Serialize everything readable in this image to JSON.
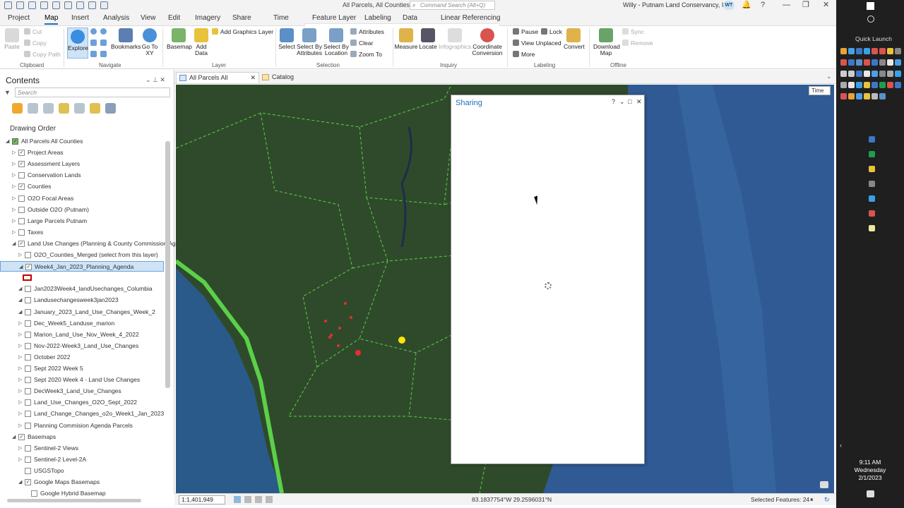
{
  "titlebar": {
    "doc_title": "All Parcels, All Counties",
    "search_placeholder": "Command Search (Alt+Q)",
    "user_name": "Willy - Putnam Land Conservancy, Inc.",
    "user_initials": "WT",
    "minimize": "—",
    "restore": "❐",
    "close": "✕"
  },
  "menu": {
    "tabs": [
      "Project",
      "Map",
      "Insert",
      "Analysis",
      "View",
      "Edit",
      "Imagery",
      "Share",
      "Time",
      "Feature Layer",
      "Labeling",
      "Data",
      "Linear Referencing"
    ],
    "active": "Map"
  },
  "ribbon": {
    "clipboard": {
      "paste": "Paste",
      "cut": "Cut",
      "copy": "Copy",
      "copy_path": "Copy Path",
      "group": "Clipboard"
    },
    "navigate": {
      "explore": "Explore",
      "bookmarks": "Bookmarks",
      "go_to_xy": "Go To XY",
      "group": "Navigate"
    },
    "layer": {
      "basemap": "Basemap",
      "add_data": "Add Data",
      "add_graphics_layer": "Add Graphics Layer",
      "group": "Layer"
    },
    "selection": {
      "select": "Select",
      "select_by_attributes": "Select By Attributes",
      "select_by_location": "Select By Location",
      "attributes": "Attributes",
      "clear": "Clear",
      "zoom_to": "Zoom To",
      "group": "Selection"
    },
    "inquiry": {
      "measure": "Measure",
      "locate": "Locate",
      "infographics": "Infographics",
      "coordinate_conversion": "Coordinate Conversion",
      "group": "Inquiry"
    },
    "labeling": {
      "pause": "Pause",
      "lock": "Lock",
      "view_unplaced": "View Unplaced",
      "more": "More",
      "convert": "Convert",
      "group": "Labeling"
    },
    "offline": {
      "download_map": "Download Map",
      "sync": "Sync",
      "remove": "Remove",
      "group": "Offline"
    }
  },
  "contents": {
    "title": "Contents",
    "search_placeholder": "Search",
    "drawing_order": "Drawing Order",
    "items": [
      {
        "label": "All Parcels All Counties",
        "level": 0,
        "twisty": "◢",
        "checked": true,
        "kind": "map"
      },
      {
        "label": "Project Areas",
        "level": 1,
        "twisty": "▷",
        "checked": true
      },
      {
        "label": "Assessment Layers",
        "level": 1,
        "twisty": "▷",
        "checked": true
      },
      {
        "label": "Conservation Lands",
        "level": 1,
        "twisty": "▷",
        "checked": false
      },
      {
        "label": "Counties",
        "level": 1,
        "twisty": "▷",
        "checked": true
      },
      {
        "label": "O2O Focal Areas",
        "level": 1,
        "twisty": "▷",
        "checked": false
      },
      {
        "label": "Outside O2O (Putnam)",
        "level": 1,
        "twisty": "▷",
        "checked": false
      },
      {
        "label": "Large Parcels Putnam",
        "level": 1,
        "twisty": "▷",
        "checked": false
      },
      {
        "label": "Taxes",
        "level": 1,
        "twisty": "▷",
        "checked": false
      },
      {
        "label": "Land Use Changes (Planning & County Commission Ag",
        "level": 1,
        "twisty": "◢",
        "checked": true
      },
      {
        "label": "O2O_Counties_Merged (select from this layer)",
        "level": 2,
        "twisty": "▷",
        "checked": false
      },
      {
        "label": "Week4_Jan_2023_Planning_Agenda",
        "level": 2,
        "twisty": "◢",
        "checked": true,
        "selected": true
      },
      {
        "label": "",
        "level": 3,
        "twisty": "",
        "checked": null,
        "symbol": true
      },
      {
        "label": "Jan2023Week4_landUsechanges_Columbia",
        "level": 2,
        "twisty": "◢",
        "checked": false
      },
      {
        "label": "Landusechangesweek3jan2023",
        "level": 2,
        "twisty": "◢",
        "checked": false
      },
      {
        "label": "January_2023_Land_Use_Changes_Week_2",
        "level": 2,
        "twisty": "◢",
        "checked": false
      },
      {
        "label": "Dec_Week5_Landuse_marion",
        "level": 2,
        "twisty": "▷",
        "checked": false
      },
      {
        "label": "Marion_Land_Use_Nov_Week_4_2022",
        "level": 2,
        "twisty": "▷",
        "checked": false
      },
      {
        "label": "Nov-2022-Week3_Land_Use_Changes",
        "level": 2,
        "twisty": "▷",
        "checked": false
      },
      {
        "label": "October 2022",
        "level": 2,
        "twisty": "▷",
        "checked": false
      },
      {
        "label": "Sept 2022 Week 5",
        "level": 2,
        "twisty": "▷",
        "checked": false
      },
      {
        "label": "Sept 2020 Week 4 - Land Use Changes",
        "level": 2,
        "twisty": "▷",
        "checked": false
      },
      {
        "label": "DecWeek3_Land_Use_Changes",
        "level": 2,
        "twisty": "▷",
        "checked": false
      },
      {
        "label": "Land_Use_Changes_O2O_Sept_2022",
        "level": 2,
        "twisty": "▷",
        "checked": false
      },
      {
        "label": "Land_Change_Changes_o2o_Week1_Jan_2023",
        "level": 2,
        "twisty": "▷",
        "checked": false
      },
      {
        "label": "Planning Commision Agenda Parcels",
        "level": 2,
        "twisty": "▷",
        "checked": false
      },
      {
        "label": "Basemaps",
        "level": 1,
        "twisty": "◢",
        "checked": true
      },
      {
        "label": "Sentinel-2 Views",
        "level": 2,
        "twisty": "▷",
        "checked": false
      },
      {
        "label": "Sentinel-2 Level-2A",
        "level": 2,
        "twisty": "▷",
        "checked": false
      },
      {
        "label": "USGSTopo",
        "level": 2,
        "twisty": "",
        "checked": false
      },
      {
        "label": "Google Maps Basemaps",
        "level": 2,
        "twisty": "◢",
        "checked": true
      },
      {
        "label": "Google Hybrid Basemap",
        "level": 3,
        "twisty": "",
        "checked": false
      }
    ]
  },
  "doc_tabs": {
    "map": "All Parcels All Counties",
    "catalog": "Catalog",
    "close": "✕"
  },
  "map": {
    "time_button": "Time",
    "land_color": "#2f4a2a",
    "ocean_color": "#2f5a94",
    "boundary_color": "#5bd04a"
  },
  "sharing": {
    "title": "Sharing",
    "help": "?",
    "menu": "⌄",
    "maximize": "□",
    "close": "✕"
  },
  "status": {
    "scale": "1:1,401,949",
    "coordinates": "83.1837754°W 29.2596031°N",
    "selected_features": "Selected Features: 24"
  },
  "taskbar": {
    "quick_launch": "Quick Launch",
    "time": "9:11 AM",
    "day": "Wednesday",
    "date": "2/1/2023"
  }
}
